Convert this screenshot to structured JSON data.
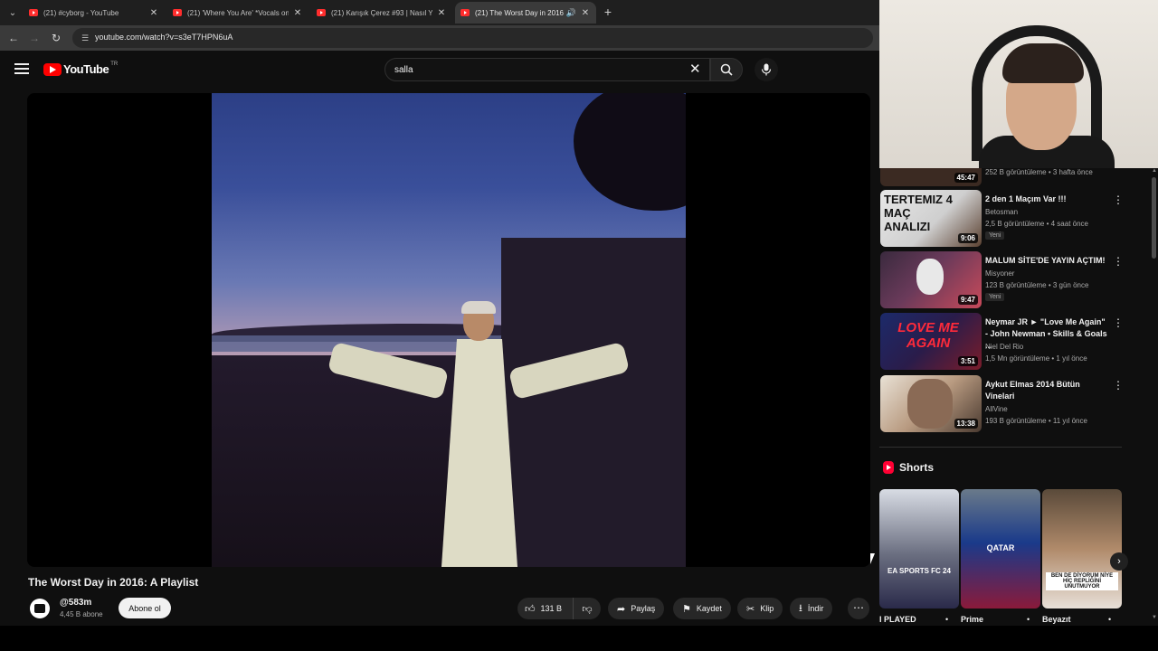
{
  "browser": {
    "tabs": [
      {
        "title": "(21) #cyborg - YouTube",
        "active": false
      },
      {
        "title": "(21) 'Where You Are' *Vocals on",
        "active": false
      },
      {
        "title": "(21) Karışık Çerez #93 | Nasıl Yı",
        "active": false
      },
      {
        "title": "(21) The Worst Day in 2016",
        "active": true
      }
    ],
    "url": "youtube.com/watch?v=s3eT7HPN6uA"
  },
  "header": {
    "logo_text": "YouTube",
    "region": "TR",
    "search_value": "salla"
  },
  "video": {
    "title": "The Worst Day in 2016: A Playlist",
    "channel": "@583m",
    "subscribers": "4,45 B abone",
    "subscribe_label": "Abone ol",
    "likes": "131 B",
    "share_label": "Paylaş",
    "save_label": "Kaydet",
    "clip_label": "Klip",
    "download_label": "İndir"
  },
  "sidebar": {
    "partial_meta": "252 B görüntüleme • 3 hafta önce",
    "partial_duration": "45:47",
    "items": [
      {
        "title": "2 den 1 Maçım Var !!!",
        "channel": "Betosman",
        "meta": "2,5 B görüntüleme • 4 saat önce",
        "badge": "Yeni",
        "duration": "9:06",
        "thumb_text": "TERTEMIZ 4 MAÇ ANALIZI"
      },
      {
        "title": "MALUM SİTE'DE YAYIN AÇTIM!",
        "channel": "Misyoner",
        "meta": "123 B görüntüleme • 3 gün önce",
        "badge": "Yeni",
        "duration": "9:47",
        "thumb_text": ""
      },
      {
        "title": "Neymar JR ► \"Love Me Again\" - John Newman • Skills & Goals ...",
        "channel": "Niel Del Rio",
        "meta": "1,5 Mn görüntüleme • 1 yıl önce",
        "badge": "",
        "duration": "3:51",
        "thumb_text": "LOVE ME AGAIN"
      },
      {
        "title": "Aykut Elmas 2014 Bütün Vinelari",
        "channel": "AllVine",
        "meta": "193 B görüntüleme • 11 yıl önce",
        "badge": "",
        "duration": "13:38",
        "thumb_text": ""
      }
    ]
  },
  "shorts": {
    "heading": "Shorts",
    "items": [
      {
        "label": "I PLAYED",
        "overlay": "EA SPORTS FC 24"
      },
      {
        "label": "Prime",
        "overlay": "QATAR"
      },
      {
        "label": "Beyazıt",
        "overlay": "BEN DE DİYORUM NİYE HİÇ REPLİĞİNİ UNUTMUYOR"
      }
    ]
  }
}
